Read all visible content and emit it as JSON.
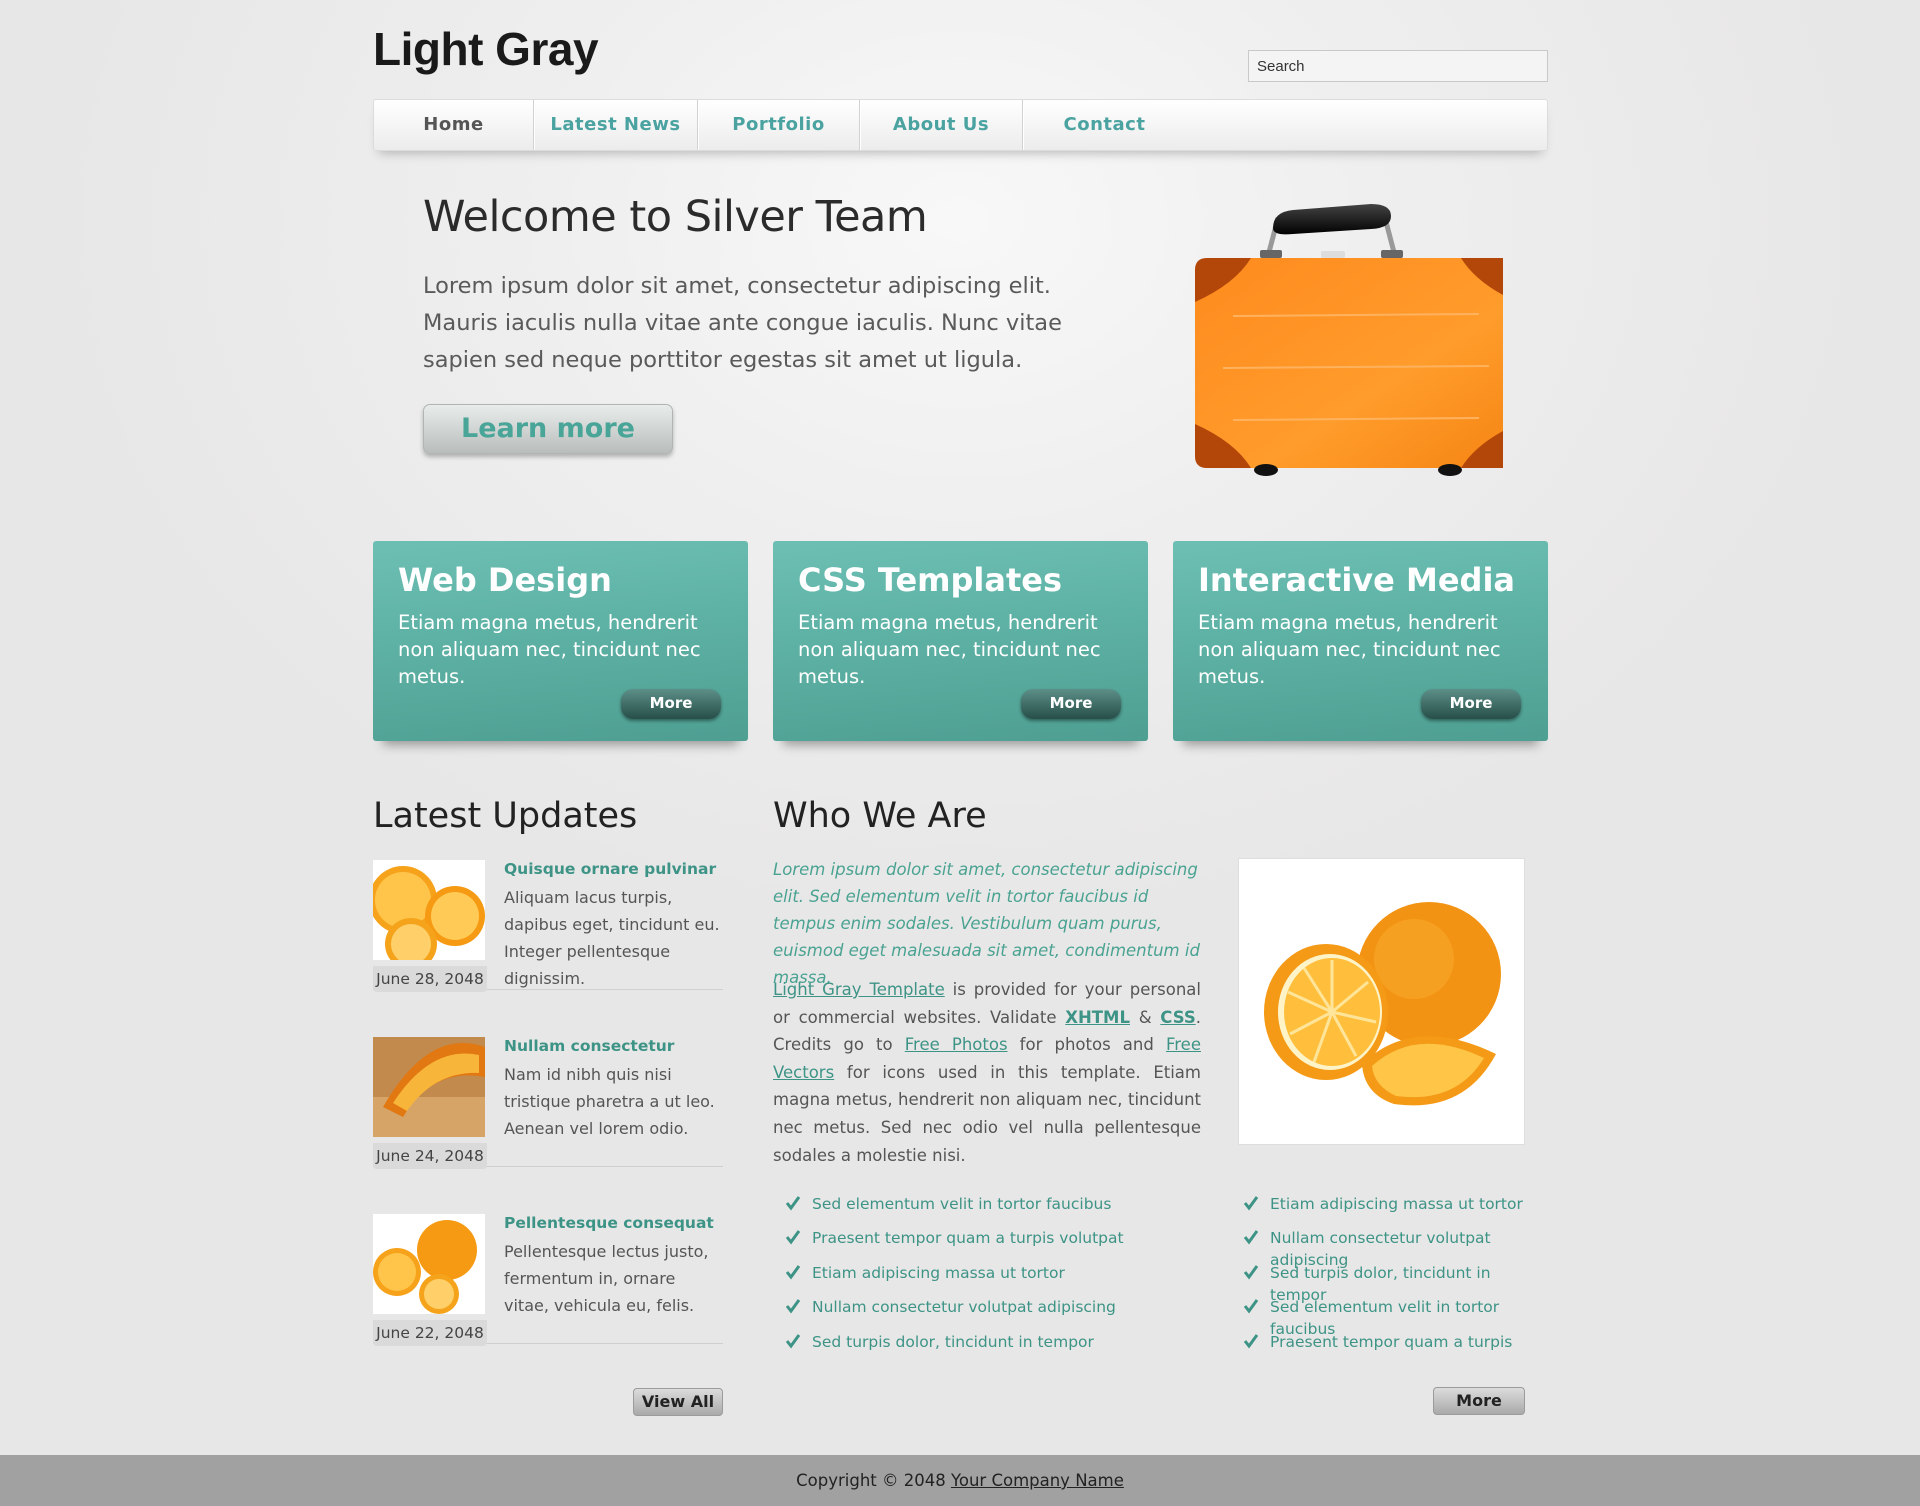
{
  "header": {
    "logo": "Light Gray",
    "search_placeholder": "Search"
  },
  "nav": {
    "items": [
      {
        "label": "Home"
      },
      {
        "label": "Latest News"
      },
      {
        "label": "Portfolio"
      },
      {
        "label": "About Us"
      },
      {
        "label": "Contact"
      }
    ]
  },
  "hero": {
    "title": "Welcome to Silver Team",
    "text": "Lorem ipsum dolor sit amet, consectetur adipiscing elit. Mauris iaculis nulla vitae ante congue iaculis. Nunc vitae sapien sed neque porttitor egestas sit amet ut ligula.",
    "button": "Learn more"
  },
  "features": [
    {
      "title": "Web Design",
      "text": "Etiam magna metus, hendrerit non aliquam nec, tincidunt nec metus.",
      "button": "More"
    },
    {
      "title": "CSS Templates",
      "text": "Etiam magna metus, hendrerit non aliquam nec, tincidunt nec metus.",
      "button": "More"
    },
    {
      "title": "Interactive Media",
      "text": "Etiam magna metus, hendrerit non aliquam nec, tincidunt nec metus.",
      "button": "More"
    }
  ],
  "updates": {
    "title": "Latest Updates",
    "items": [
      {
        "title": "Quisque ornare pulvinar",
        "text": "Aliquam lacus turpis, dapibus eget, tincidunt eu. Integer pellentesque dignissim.",
        "date": "June 28, 2048"
      },
      {
        "title": "Nullam consectetur",
        "text": "Nam id nibh quis nisi tristique pharetra a ut leo. Aenean vel lorem odio.",
        "date": "June 24, 2048"
      },
      {
        "title": "Pellentesque consequat",
        "text": "Pellentesque lectus justo, fermentum in, ornare vitae, vehicula eu, felis.",
        "date": "June 22, 2048"
      }
    ],
    "view_all": "View All"
  },
  "about": {
    "title": "Who We Are",
    "intro": "Lorem ipsum dolor sit amet, consectetur adipiscing elit. Sed elementum velit in tortor faucibus id tempus enim sodales. Vestibulum quam purus, euismod eget malesuada sit amet, condimentum id massa.",
    "link_template": "Light Gray Template",
    "t1": " is provided for your personal or commercial websites. Validate ",
    "link_xhtml": "XHTML",
    "t2": " & ",
    "link_css": "CSS",
    "t3": ". Credits go to ",
    "link_photos": "Free Photos",
    "t4": " for photos and ",
    "link_vectors": "Free Vectors",
    "t5": " for icons used in this template. Etiam magna metus, hendrerit non aliquam nec, tincidunt nec metus. Sed nec odio vel nulla pellentesque sodales a molestie nisi.",
    "list_left": [
      "Sed elementum velit in tortor faucibus",
      "Praesent tempor quam a turpis volutpat",
      "Etiam adipiscing massa ut tortor",
      "Nullam consectetur volutpat adipiscing",
      "Sed turpis dolor, tincidunt in tempor"
    ],
    "list_right": [
      "Etiam adipiscing massa ut tortor",
      "Nullam consectetur volutpat adipiscing",
      "Sed turpis dolor, tincidunt in tempor",
      "Sed elementum velit in tortor faucibus",
      "Praesent tempor quam a turpis"
    ],
    "more": "More"
  },
  "footer": {
    "text": "Copyright © 2048 ",
    "link": "Your Company Name"
  },
  "colors": {
    "accent": "#4aa3a0",
    "feature_box": "#5fb3a6",
    "footer": "#a1a1a1"
  }
}
